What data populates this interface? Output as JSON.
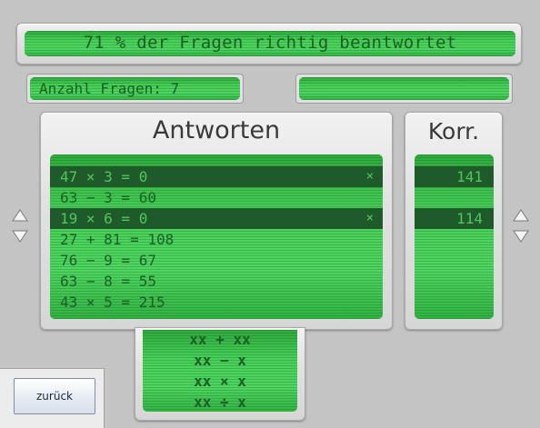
{
  "status": {
    "text": "71 % der Fragen richtig beantwortet"
  },
  "question_count": {
    "text": "Anzahl Fragen: 7"
  },
  "answers": {
    "title": "Antworten",
    "rows": [
      {
        "text": "47 × 3 = 0",
        "mark": "×",
        "highlighted": true
      },
      {
        "text": "63 − 3 = 60",
        "mark": "",
        "highlighted": false
      },
      {
        "text": "19 × 6 = 0",
        "mark": "×",
        "highlighted": true
      },
      {
        "text": "27 + 81 = 108",
        "mark": "",
        "highlighted": false
      },
      {
        "text": "76 − 9 = 67",
        "mark": "",
        "highlighted": false
      },
      {
        "text": "63 − 8 = 55",
        "mark": "",
        "highlighted": false
      },
      {
        "text": "43 × 5 = 215",
        "mark": "",
        "highlighted": false
      }
    ]
  },
  "corrections": {
    "title": "Korr.",
    "rows": [
      {
        "text": "141",
        "highlighted": true
      },
      {
        "text": "",
        "highlighted": false
      },
      {
        "text": "114",
        "highlighted": true
      },
      {
        "text": "",
        "highlighted": false
      },
      {
        "text": "",
        "highlighted": false
      },
      {
        "text": "",
        "highlighted": false
      },
      {
        "text": "",
        "highlighted": false
      }
    ]
  },
  "operations": [
    "xx + xx",
    "xx − x",
    "xx × x",
    "xx ÷ x"
  ],
  "back_button": {
    "label": "zurück"
  },
  "icons": {
    "scroll_up": "triangle-up-icon",
    "scroll_down": "triangle-down-icon"
  },
  "colors": {
    "lcd_green": "#48d05a",
    "lcd_text": "#1c5e23",
    "highlight_row": "#1f5a2a"
  }
}
